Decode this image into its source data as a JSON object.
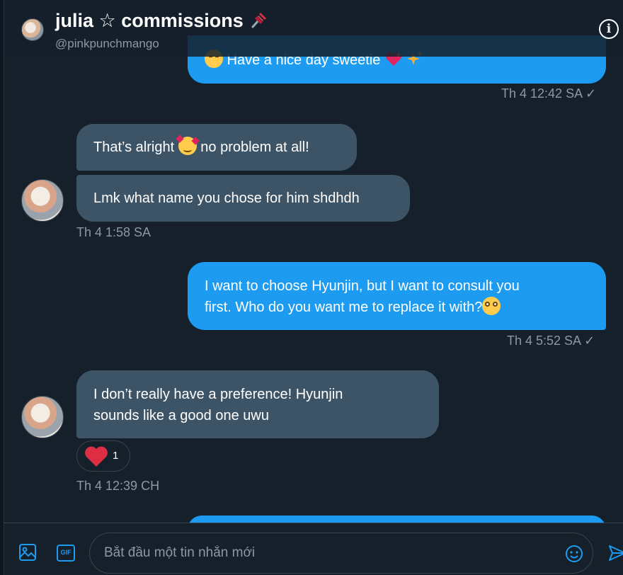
{
  "header": {
    "title": "julia ☆ commissions",
    "handle": "@pinkpunchmango"
  },
  "messages": {
    "m1": {
      "text": "Have a nice day sweetie",
      "time": "Th 4 12:42 SA",
      "check": "✓"
    },
    "m2": {
      "text_before": "That’s alright",
      "text_after": "no problem at all!"
    },
    "m3": {
      "text": "Lmk what name you chose for him shdhdh",
      "time": "Th 4 1:58 SA"
    },
    "m4": {
      "line1": "I want to choose Hyunjin, but I want to consult you",
      "line2": "first. Who do you want me to replace it with?",
      "time": "Th 4 5:52 SA",
      "check": "✓"
    },
    "m5": {
      "line1": "I don’t really have a preference! Hyunjin",
      "line2": "sounds like a good one uwu",
      "time": "Th 4 12:39 CH",
      "reaction_count": "1"
    }
  },
  "composer": {
    "placeholder": "Bắt đầu một tin nhắn mới",
    "gif_label": "GIF"
  },
  "colors": {
    "background": "#15202b",
    "outgoing_bubble": "#1d9bf0",
    "incoming_bubble": "#3d5466",
    "muted_text": "#8b98a5",
    "heart": "#e0245e"
  }
}
